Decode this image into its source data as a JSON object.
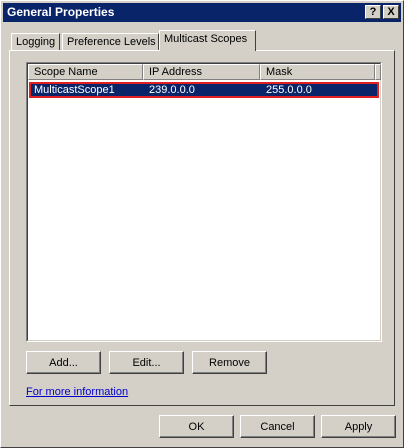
{
  "window": {
    "title": "General Properties",
    "help_label": "?",
    "close_label": "X"
  },
  "tabs": [
    {
      "label": "Logging"
    },
    {
      "label": "Preference Levels"
    },
    {
      "label": "Multicast Scopes"
    }
  ],
  "table": {
    "columns": [
      "Scope Name",
      "IP Address",
      "Mask"
    ],
    "rows": [
      {
        "name": "MulticastScope1",
        "ip": "239.0.0.0",
        "mask": "255.0.0.0",
        "selected": true
      }
    ]
  },
  "panel_buttons": {
    "add": "Add...",
    "edit": "Edit...",
    "remove": "Remove"
  },
  "link": {
    "text": "For more information"
  },
  "dialog_buttons": {
    "ok": "OK",
    "cancel": "Cancel",
    "apply": "Apply"
  },
  "colors": {
    "titlebar": "#0a246a",
    "selection": "#0a246a",
    "selection_border": "#e02020",
    "face": "#d4d0c8",
    "link": "#0000cc"
  }
}
